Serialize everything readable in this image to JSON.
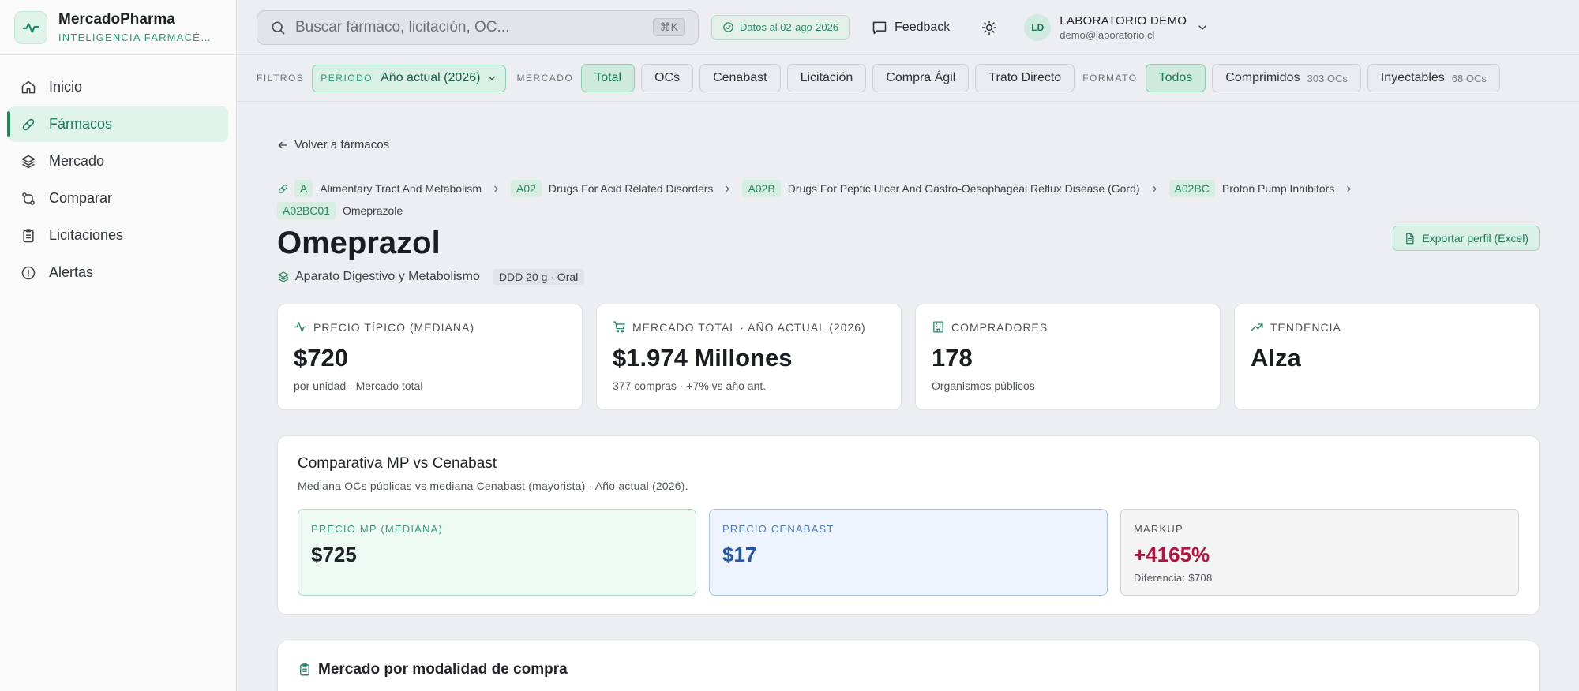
{
  "brand": {
    "name": "MercadoPharma",
    "subtitle": "INTELIGENCIA FARMACÉUTICA"
  },
  "nav": [
    {
      "label": "Inicio",
      "icon": "home-icon",
      "active": false
    },
    {
      "label": "Fármacos",
      "icon": "pill-icon",
      "active": true
    },
    {
      "label": "Mercado",
      "icon": "layers-icon",
      "active": false
    },
    {
      "label": "Comparar",
      "icon": "compare-icon",
      "active": false
    },
    {
      "label": "Licitaciones",
      "icon": "clipboard-icon",
      "active": false
    },
    {
      "label": "Alertas",
      "icon": "alert-icon",
      "active": false
    }
  ],
  "topbar": {
    "search_placeholder": "Buscar fármaco, licitación, OC...",
    "search_shortcut": "⌘K",
    "data_date": "Datos al 02-ago-2026",
    "feedback": "Feedback",
    "user_initials": "LD",
    "user_name": "LABORATORIO DEMO",
    "user_email": "demo@laboratorio.cl"
  },
  "filters": {
    "label": "FILTROS",
    "period_label": "PERIODO",
    "period_value": "Año actual (2026)",
    "market_label": "MERCADO",
    "market_options": [
      "Total",
      "OCs",
      "Cenabast",
      "Licitación",
      "Compra Ágil",
      "Trato Directo"
    ],
    "market_selected": "Total",
    "format_label": "FORMATO",
    "format_options": [
      {
        "label": "Todos",
        "count": ""
      },
      {
        "label": "Comprimidos",
        "count": "303 OCs"
      },
      {
        "label": "Inyectables",
        "count": "68 OCs"
      }
    ],
    "format_selected": "Todos"
  },
  "page": {
    "back": "Volver a fármacos",
    "breadcrumb": [
      {
        "code": "A",
        "label": "Alimentary Tract And Metabolism"
      },
      {
        "code": "A02",
        "label": "Drugs For Acid Related Disorders"
      },
      {
        "code": "A02B",
        "label": "Drugs For Peptic Ulcer And Gastro-Oesophageal Reflux Disease (Gord)"
      },
      {
        "code": "A02BC",
        "label": "Proton Pump Inhibitors"
      },
      {
        "code": "A02BC01",
        "label": "Omeprazole"
      }
    ],
    "title": "Omeprazol",
    "export": "Exportar perfil (Excel)",
    "category": "Aparato Digestivo y Metabolismo",
    "ddd": "DDD 20 g · Oral"
  },
  "kpis": [
    {
      "label": "PRECIO TÍPICO (MEDIANA)",
      "value": "$720",
      "sub": "por unidad · Mercado total",
      "icon": "activity-icon"
    },
    {
      "label": "MERCADO TOTAL · AÑO ACTUAL (2026)",
      "value": "$1.974 Millones",
      "sub": "377 compras · +7% vs año ant.",
      "icon": "cart-icon"
    },
    {
      "label": "COMPRADORES",
      "value": "178",
      "sub": "Organismos públicos",
      "icon": "building-icon"
    },
    {
      "label": "TENDENCIA",
      "value": "Alza",
      "sub": "",
      "icon": "trending-up-icon"
    }
  ],
  "comparison": {
    "title": "Comparativa MP vs Cenabast",
    "subtitle": "Mediana OCs públicas vs mediana Cenabast (mayorista) · Año actual (2026).",
    "mp_label": "PRECIO MP (MEDIANA)",
    "mp_value": "$725",
    "cenabast_label": "PRECIO CENABAST",
    "cenabast_value": "$17",
    "markup_label": "MARKUP",
    "markup_value": "+4165%",
    "markup_diff": "Diferencia: $708"
  },
  "section2": {
    "title": "Mercado por modalidad de compra"
  }
}
